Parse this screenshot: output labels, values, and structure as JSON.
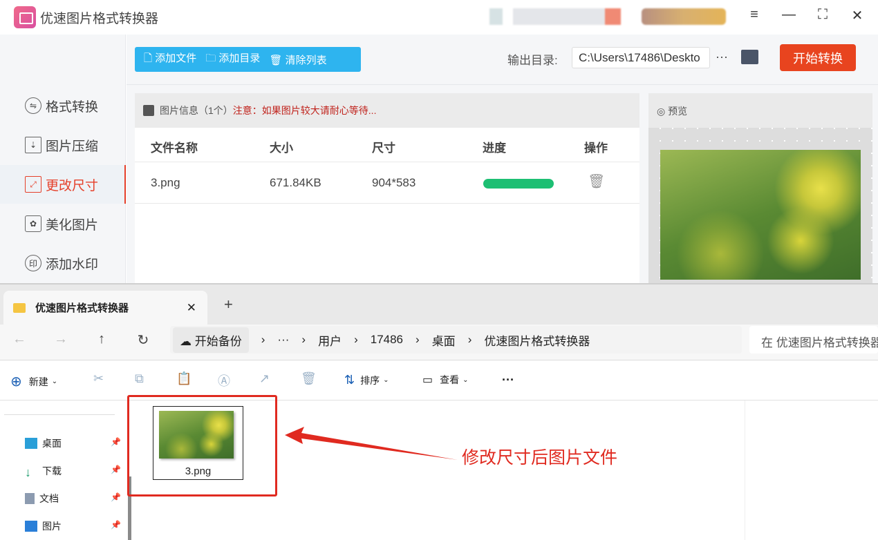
{
  "app": {
    "title": "优速图片格式转换器",
    "window_controls": [
      "menu-icon",
      "minimize-icon",
      "maximize-icon",
      "close-icon"
    ]
  },
  "sidebar": {
    "items": [
      {
        "label": "格式转换",
        "icon": "⇋"
      },
      {
        "label": "图片压缩",
        "icon": "⇣"
      },
      {
        "label": "更改尺寸",
        "icon": "⤢",
        "active": true
      },
      {
        "label": "美化图片",
        "icon": "✿"
      },
      {
        "label": "添加水印",
        "icon": "印"
      }
    ]
  },
  "toolbar": {
    "add_file": "添加文件",
    "add_dir": "添加目录",
    "clear_list": "清除列表",
    "output_label": "输出目录:",
    "output_path": "C:\\Users\\17486\\Deskto",
    "more": "···",
    "start": "开始转换"
  },
  "list": {
    "header": "图片信息（1个）",
    "note": "注意：如果图片较大请耐心等待...",
    "columns": [
      "文件名称",
      "大小",
      "尺寸",
      "进度",
      "操作"
    ],
    "rows": [
      {
        "name": "3.png",
        "size": "671.84KB",
        "dims": "904*583",
        "progress": 1.0
      }
    ]
  },
  "preview": {
    "label": "预览"
  },
  "explorer": {
    "tab": "优速图片格式转换器",
    "new_tab": "+",
    "breadcrumb": [
      "开始备份",
      "···",
      "用户",
      "17486",
      "桌面",
      "优速图片格式转换器"
    ],
    "search_placeholder": "在 优速图片格式转换器",
    "commands": {
      "new": "新建",
      "sort": "排序",
      "view": "查看",
      "more": "···"
    },
    "nav": [
      {
        "label": "桌面"
      },
      {
        "label": "下载"
      },
      {
        "label": "文档"
      },
      {
        "label": "图片"
      }
    ],
    "file": {
      "name": "3.png"
    }
  },
  "annotation": "修改尺寸后图片文件",
  "colors": {
    "accent": "#2eb4ef",
    "start": "#e8441f",
    "active": "#e5402a",
    "progress": "#1dbf73",
    "annotation": "#e02a20"
  }
}
